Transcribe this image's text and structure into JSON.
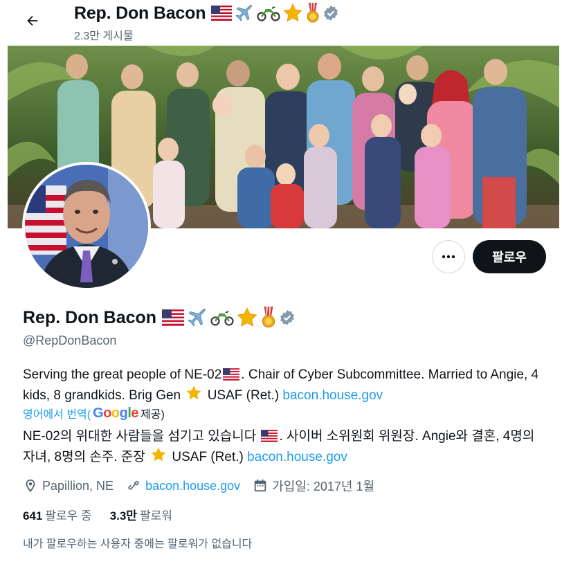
{
  "header": {
    "name": "Rep. Don Bacon",
    "posts": "2.3만 게시물"
  },
  "profile": {
    "name": "Rep. Don Bacon",
    "handle": "@RepDonBacon",
    "follow_label": "팔로우",
    "more_label": "•••"
  },
  "bio": {
    "part1": "Serving the great people of NE-02",
    "part2": ". Chair of Cyber Subcommittee. Married to Angie, 4 kids, 8 grandkids. Brig Gen",
    "part3": "USAF (Ret.)",
    "link": "bacon.house.gov"
  },
  "translate": {
    "label": "영어에서 번역(",
    "google": "Google",
    "suffix": "제공)",
    "part1": "NE-02의 위대한 사람들을 섬기고 있습니다",
    "part2": ". 사이버 소위원회 위원장. Angie와 결혼, 4명의 자녀, 8명의 손주. 준장",
    "part3": "USAF (Ret.)",
    "link": "bacon.house.gov"
  },
  "meta": {
    "location": "Papillion, NE",
    "website": "bacon.house.gov",
    "joined": "가입일: 2017년 1월"
  },
  "stats": {
    "following_count": "641",
    "following_label": "팔로우 중",
    "followers_count": "3.3만",
    "followers_label": "팔로워"
  },
  "mutual_text": "내가 팔로우하는 사용자 중에는 팔로워가 없습니다",
  "colors": {
    "accent": "#1d9bf0",
    "text": "#0f1419",
    "secondary": "#536471",
    "verified": "#829aab"
  },
  "icons": [
    "back-arrow-icon",
    "us-flag-icon",
    "airplane-icon",
    "motorcycle-icon",
    "star-icon",
    "medal-icon",
    "verified-badge-icon",
    "more-icon",
    "location-icon",
    "link-icon",
    "calendar-icon"
  ]
}
